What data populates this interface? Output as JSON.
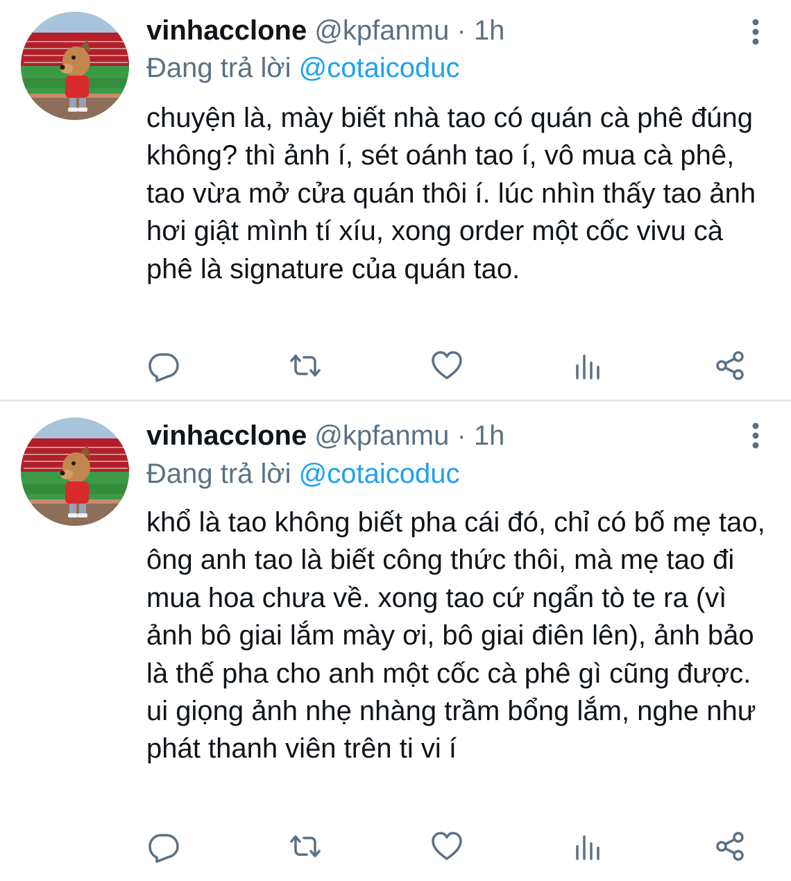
{
  "tweets": [
    {
      "display_name": "vinhacclone",
      "handle": "@kpfanmu",
      "separator": "·",
      "time": "1h",
      "reply_prefix": "Đang trả lời",
      "reply_to": "@cotaicoduc",
      "text": "chuyện là, mày biết nhà tao có quán cà phê đúng không? thì ảnh í, sét oánh tao í, vô mua cà phê, tao vừa mở cửa quán thôi í. lúc nhìn thấy tao ảnh hơi giật mình tí xíu, xong order một cốc vivu cà phê là signature của quán tao."
    },
    {
      "display_name": "vinhacclone",
      "handle": "@kpfanmu",
      "separator": "·",
      "time": "1h",
      "reply_prefix": "Đang trả lời",
      "reply_to": "@cotaicoduc",
      "text": "khổ là tao không biết pha cái đó, chỉ có bố mẹ tao, ông anh tao là biết công thức thôi, mà mẹ tao đi mua hoa chưa về. xong tao cứ ngẩn tò te ra (vì ảnh bô giai lắm mày ơi, bô giai điên lên), ảnh bảo là thế pha cho anh một cốc cà phê gì cũng được. ui giọng ảnh nhẹ nhàng trầm bổng lắm, nghe như phát thanh viên trên ti vi í"
    }
  ],
  "icons": {
    "reply": "reply-icon",
    "retweet": "retweet-icon",
    "like": "heart-icon",
    "analytics": "analytics-icon",
    "share": "share-icon",
    "more": "more-vertical-icon"
  },
  "colors": {
    "text": "#0f1419",
    "secondary": "#5b7083",
    "link": "#1da1f2",
    "divider": "#e6ecf0"
  }
}
